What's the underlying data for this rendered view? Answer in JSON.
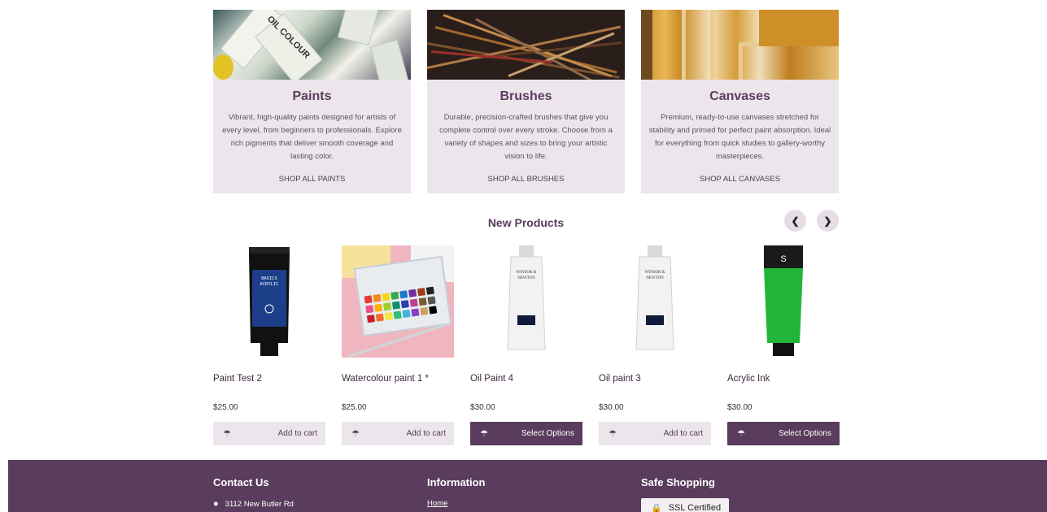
{
  "categories": [
    {
      "title": "Paints",
      "description": "Vibrant, high-quality paints designed for artists of every level, from beginners to professionals. Explore rich pigments that deliver smooth coverage and lasting color.",
      "link": "SHOP ALL PAINTS",
      "image_text": "OIL COLOUR"
    },
    {
      "title": "Brushes",
      "description": "Durable, precision-crafted brushes that give you complete control over every stroke. Choose from a variety of shapes and sizes to bring your artistic vision to life.",
      "link": "SHOP ALL BRUSHES"
    },
    {
      "title": "Canvases",
      "description": "Premium, ready-to-use canvases stretched for stability and primed for perfect paint absorption. Ideal for everything from quick studies to gallery-worthy masterpieces.",
      "link": "SHOP ALL CANVASES"
    }
  ],
  "new_products": {
    "title": "New Products",
    "prev_icon": "chevron-left-icon",
    "next_icon": "chevron-right-icon",
    "items": [
      {
        "name": "Paint Test 2",
        "price": "$25.00",
        "button": "Add to cart",
        "style": "light",
        "brand_text": "BASICS ACRYLIC",
        "tube_color": "#1d3f8a"
      },
      {
        "name": "Watercolour paint 1 *",
        "price": "$25.00",
        "button": "Add to cart",
        "style": "light"
      },
      {
        "name": "Oil Paint 4",
        "price": "$30.00",
        "button": "Select Options",
        "style": "dark",
        "brand_text": "WINSOR & NEWTON",
        "tube_color": "#121a3a"
      },
      {
        "name": "Oil paint 3",
        "price": "$30.00",
        "button": "Add to cart",
        "style": "light",
        "brand_text": "WINSOR & NEWTON",
        "tube_color": "#121a3a"
      },
      {
        "name": "Acrylic Ink",
        "price": "$30.00",
        "button": "Select Options",
        "style": "dark",
        "tube_color": "#21b53a"
      }
    ]
  },
  "footer": {
    "contact_title": "Contact Us",
    "address": "3112 New Butler Rd",
    "info_title": "Information",
    "home_link": "Home",
    "safe_title": "Safe Shopping",
    "ssl_label": "SSL Certified"
  },
  "colors": {
    "brand": "#5a3d5c",
    "card_bg": "#ece6ec"
  }
}
